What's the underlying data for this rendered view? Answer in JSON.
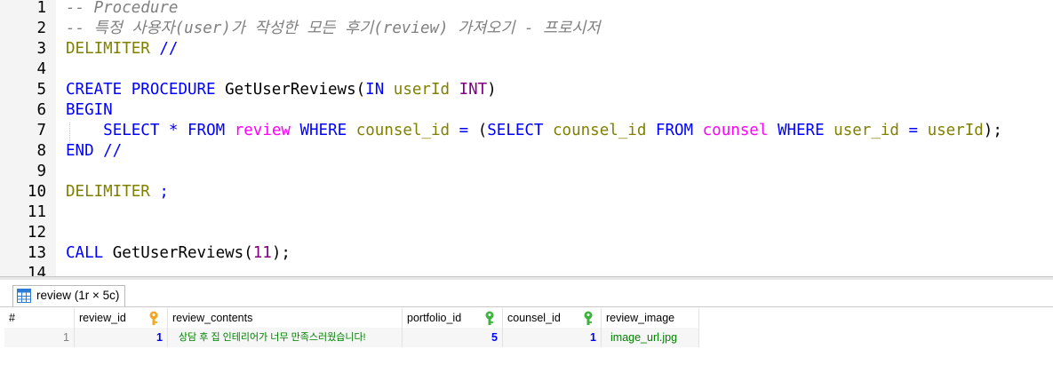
{
  "editor": {
    "lines": [
      {
        "num": "1",
        "segs": [
          {
            "t": "-- Procedure",
            "c": "cmt"
          }
        ]
      },
      {
        "num": "2",
        "segs": [
          {
            "t": "-- 특정 사용자(user)가 작성한 모든 후기(review) 가져오기 - 프로시저",
            "c": "cmt"
          }
        ]
      },
      {
        "num": "3",
        "segs": [
          {
            "t": "DELIMITER",
            "c": "kw2"
          },
          {
            "t": " //",
            "c": "kw"
          }
        ]
      },
      {
        "num": "4",
        "segs": []
      },
      {
        "num": "5",
        "segs": [
          {
            "t": "CREATE",
            "c": "kw"
          },
          {
            "t": " ",
            "c": ""
          },
          {
            "t": "PROCEDURE",
            "c": "kw"
          },
          {
            "t": " GetUserReviews(",
            "c": ""
          },
          {
            "t": "IN",
            "c": "kw"
          },
          {
            "t": " ",
            "c": ""
          },
          {
            "t": "userId",
            "c": "kw2"
          },
          {
            "t": " ",
            "c": ""
          },
          {
            "t": "INT",
            "c": "num"
          },
          {
            "t": ")",
            "c": ""
          }
        ]
      },
      {
        "num": "6",
        "segs": [
          {
            "t": "BEGIN",
            "c": "kw"
          }
        ]
      },
      {
        "num": "7",
        "segs": [
          {
            "t": "    ",
            "c": ""
          },
          {
            "t": "SELECT",
            "c": "kw"
          },
          {
            "t": " ",
            "c": ""
          },
          {
            "t": "*",
            "c": "kw"
          },
          {
            "t": " ",
            "c": ""
          },
          {
            "t": "FROM",
            "c": "kw"
          },
          {
            "t": " ",
            "c": ""
          },
          {
            "t": "review",
            "c": "tbl"
          },
          {
            "t": " ",
            "c": ""
          },
          {
            "t": "WHERE",
            "c": "kw"
          },
          {
            "t": " ",
            "c": ""
          },
          {
            "t": "counsel_id",
            "c": "kw2"
          },
          {
            "t": " ",
            "c": ""
          },
          {
            "t": "=",
            "c": "kw"
          },
          {
            "t": " (",
            "c": ""
          },
          {
            "t": "SELECT",
            "c": "kw"
          },
          {
            "t": " ",
            "c": ""
          },
          {
            "t": "counsel_id",
            "c": "kw2"
          },
          {
            "t": " ",
            "c": ""
          },
          {
            "t": "FROM",
            "c": "kw"
          },
          {
            "t": " ",
            "c": ""
          },
          {
            "t": "counsel",
            "c": "tbl"
          },
          {
            "t": " ",
            "c": ""
          },
          {
            "t": "WHERE",
            "c": "kw"
          },
          {
            "t": " ",
            "c": ""
          },
          {
            "t": "user_id",
            "c": "kw2"
          },
          {
            "t": " ",
            "c": ""
          },
          {
            "t": "=",
            "c": "kw"
          },
          {
            "t": " ",
            "c": ""
          },
          {
            "t": "userId",
            "c": "kw2"
          },
          {
            "t": ");",
            "c": ""
          }
        ]
      },
      {
        "num": "8",
        "segs": [
          {
            "t": "END",
            "c": "kw"
          },
          {
            "t": " //",
            "c": "kw"
          }
        ]
      },
      {
        "num": "9",
        "segs": []
      },
      {
        "num": "10",
        "segs": [
          {
            "t": "DELIMITER",
            "c": "kw2"
          },
          {
            "t": " ;",
            "c": "kw"
          }
        ]
      },
      {
        "num": "11",
        "segs": []
      },
      {
        "num": "12",
        "segs": []
      },
      {
        "num": "13",
        "segs": [
          {
            "t": "CALL",
            "c": "kw"
          },
          {
            "t": " GetUserReviews(",
            "c": ""
          },
          {
            "t": "11",
            "c": "num"
          },
          {
            "t": ");",
            "c": ""
          }
        ]
      },
      {
        "num": "14",
        "segs": []
      }
    ]
  },
  "results": {
    "tab_label": "review (1r × 5c)",
    "columns": [
      {
        "label": "#",
        "key": ""
      },
      {
        "label": "review_id",
        "key": "primary"
      },
      {
        "label": "review_contents",
        "key": ""
      },
      {
        "label": "portfolio_id",
        "key": "foreign"
      },
      {
        "label": "counsel_id",
        "key": "foreign"
      },
      {
        "label": "review_image",
        "key": ""
      }
    ],
    "rows": [
      {
        "num": "1",
        "cells": [
          "1",
          "상담 후 집 인테리어가 너무 만족스러웠습니다!",
          "5",
          "1",
          "image_url.jpg"
        ]
      }
    ]
  },
  "colors": {
    "keyword": "#0000ff",
    "function_keyword": "#808000",
    "table_name": "#ff00ff",
    "number": "#800080",
    "comment": "#808080",
    "primary_key": "#f5a623",
    "foreign_key": "#3cb43c"
  }
}
